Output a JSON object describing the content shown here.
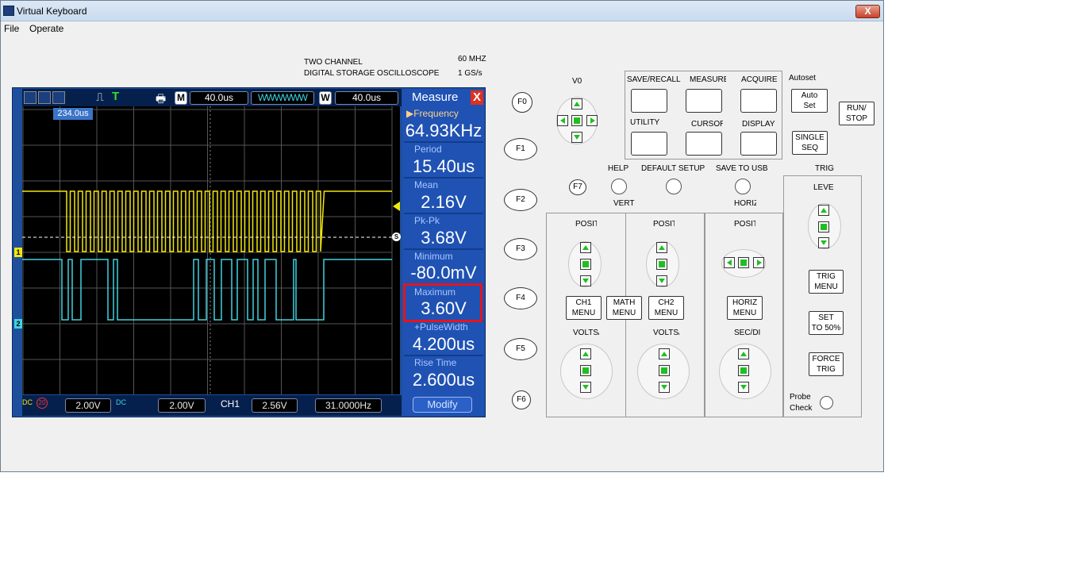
{
  "window": {
    "title": "Virtual Keyboard",
    "close": "X"
  },
  "menu": [
    "File",
    "Operate"
  ],
  "header": {
    "line1": "TWO CHANNEL",
    "line2": "DIGITAL STORAGE OSCILLOSCOPE",
    "spec1": "60 MHZ",
    "spec2": "1 GS/s"
  },
  "scope": {
    "top": {
      "m_label": "M",
      "time1": "40.0us",
      "w_label": "W",
      "time2": "40.0us"
    },
    "cursor": "234.0us",
    "bottom": {
      "ch1_coupling": "DC",
      "ch1_bw": "20",
      "ch1_volts": "2.00V",
      "ch2_coupling": "DC",
      "ch2_volts": "2.00V",
      "trig_src": "CH1",
      "trig_level": "2.56V",
      "freq": "31.0000Hz"
    },
    "markers": {
      "ch1": "1",
      "ch2": "2",
      "s": "S"
    },
    "colors": {
      "ch1": "#f2e60c",
      "ch2": "#3fd2e0",
      "panel": "#1f52b3",
      "highlight": "#e5141e"
    }
  },
  "measure": {
    "title": "Measure",
    "close": "X",
    "items": [
      {
        "label": "▶Frequency",
        "value": "64.93KHz"
      },
      {
        "label": "Period",
        "value": "15.40us"
      },
      {
        "label": "Mean",
        "value": "2.16V"
      },
      {
        "label": "Pk-Pk",
        "value": "3.68V"
      },
      {
        "label": "Minimum",
        "value": "-80.0mV"
      },
      {
        "label": "Maximum",
        "value": "3.60V"
      },
      {
        "label": "+PulseWidth",
        "value": "4.200us"
      },
      {
        "label": "Rise Time",
        "value": "2.600us"
      }
    ],
    "modify": "Modify"
  },
  "controls": {
    "fkeys": [
      "F0",
      "F1",
      "F2",
      "F3",
      "F4",
      "F5",
      "F6",
      "F7"
    ],
    "v0": "V0",
    "save_recall": "SAVE/RECALL",
    "measure": "MEASURE",
    "acquire": "ACQUIRE",
    "utility": "UTILITY",
    "cursor": "CURSOR",
    "display": "DISPLAY",
    "autoset_label": "Autoset",
    "auto_set": [
      "Auto",
      "Set"
    ],
    "single_seq": [
      "SINGLE",
      "SEQ"
    ],
    "run_stop": [
      "RUN/",
      "STOP"
    ],
    "help": "HELP",
    "default_setup": "DEFAULT SETUP",
    "save_to_usb": "SAVE TO USB",
    "trig": "TRIG",
    "vert": "VERT",
    "horiz": "HORIZ",
    "level": "LEVEL",
    "position": "POSITION",
    "ch1_menu": [
      "CH1",
      "MENU"
    ],
    "math_menu": [
      "MATH",
      "MENU"
    ],
    "ch2_menu": [
      "CH2",
      "MENU"
    ],
    "horiz_menu": [
      "HORIZ",
      "MENU"
    ],
    "volts_div": "VOLTS/DIV",
    "sec_div": "SEC/DIV",
    "trig_menu": [
      "TRIG",
      "MENU"
    ],
    "set_50": [
      "SET",
      "TO 50%"
    ],
    "force_trig": [
      "FORCE",
      "TRIG"
    ],
    "probe_check": [
      "Probe",
      "Check"
    ]
  }
}
